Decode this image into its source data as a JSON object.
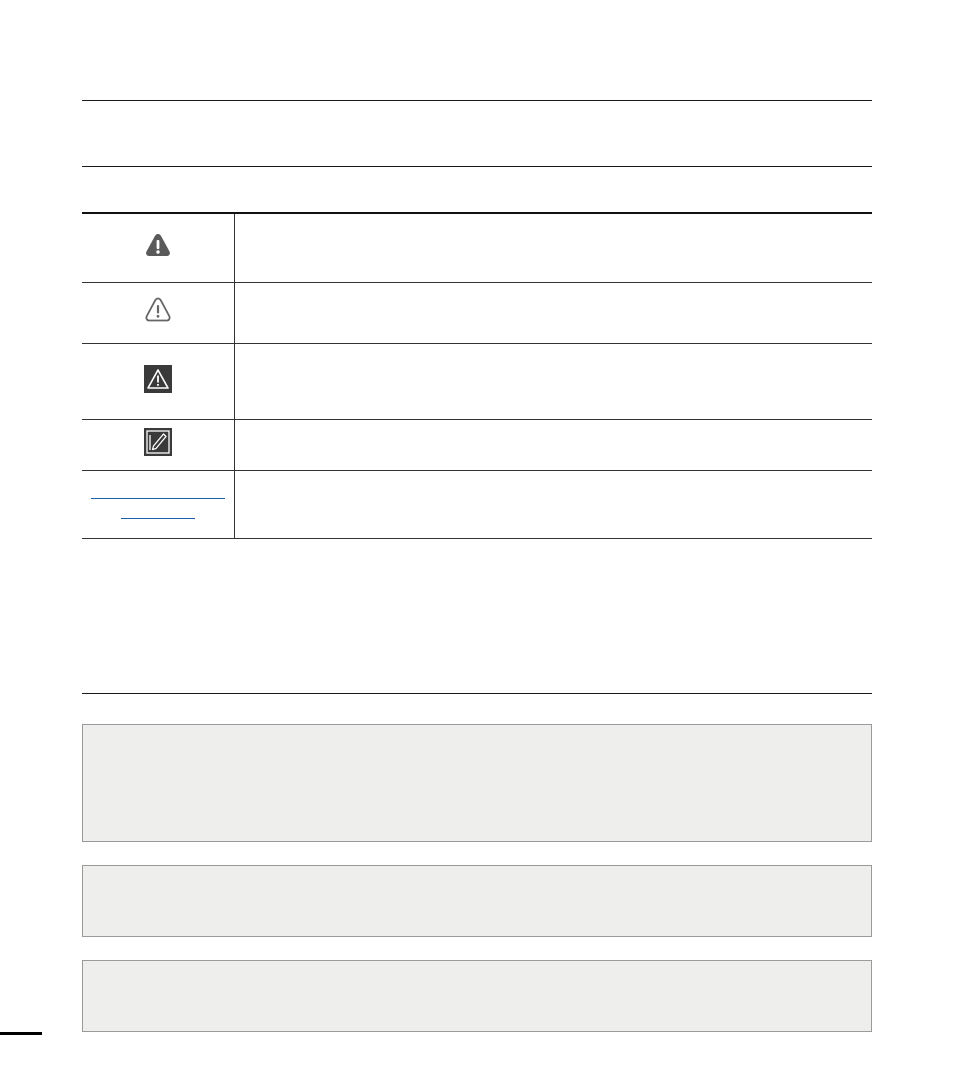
{
  "header": {
    "title": ""
  },
  "icon_table": {
    "rows": [
      {
        "icon": "warning-filled-icon",
        "description": ""
      },
      {
        "icon": "caution-outline-icon",
        "description": ""
      },
      {
        "icon": "caution-triangle-icon",
        "description": ""
      },
      {
        "icon": "note-pen-icon",
        "description": ""
      },
      {
        "icon": "link-reference",
        "description": ""
      }
    ]
  },
  "colors": {
    "rule": "#1a1a1a",
    "note_background": "#eeeeec",
    "note_border": "#9a9a9a",
    "link": "#1a5fa8",
    "icon_dark": "#555555"
  },
  "notes": [
    {
      "text": ""
    },
    {
      "text": ""
    },
    {
      "text": ""
    }
  ]
}
